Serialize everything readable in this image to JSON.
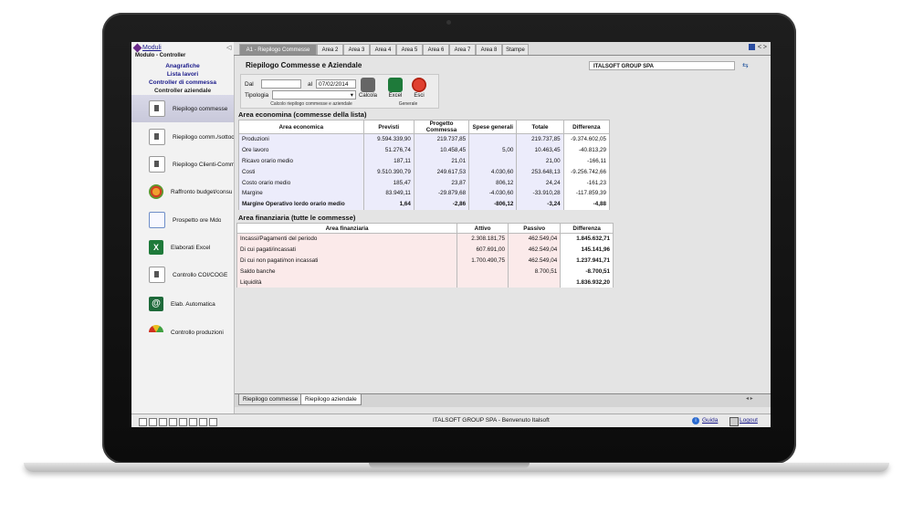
{
  "sidebar": {
    "modules_link": "Moduli",
    "module_name": "Modulo - Controller",
    "links": [
      "Anagrafiche",
      "Lista lavori",
      "Controller di commessa",
      "Controller aziendale"
    ],
    "items": [
      {
        "label": "Riepilogo commesse",
        "icon": "document-icon"
      },
      {
        "label": "Riepilogo comm./sottoc",
        "icon": "document-icon"
      },
      {
        "label": "Riepilogo Clienti-Comm",
        "icon": "document-icon"
      },
      {
        "label": "Raffronto budget/consu",
        "icon": "budget-icon"
      },
      {
        "label": "Prospetto ore Mdo",
        "icon": "calendar-clock-icon"
      },
      {
        "label": "Elaborati Excel",
        "icon": "excel-icon"
      },
      {
        "label": "Controllo COI/COGE",
        "icon": "document-icon"
      },
      {
        "label": "Elab. Automatica",
        "icon": "automation-icon"
      },
      {
        "label": "Controllo produzioni",
        "icon": "gauge-icon"
      }
    ]
  },
  "tabs": [
    "A1 - Riepilogo Commesse",
    "Area 2",
    "Area 3",
    "Area 4",
    "Area 5",
    "Area 6",
    "Area 7",
    "Area 8",
    "Stampe"
  ],
  "top_right": "< >",
  "page_title": "Riepilogo Commesse e Aziendale",
  "company": "ITALSOFT GROUP SPA",
  "filters": {
    "dal_label": "Dal",
    "dal_value": "",
    "al_label": "al",
    "al_value": "07/02/2014",
    "tipologia_label": "Tipologia",
    "tipologia_value": ""
  },
  "toolbar": {
    "calcola": "Calcola",
    "excel": "Excel",
    "esci": "Esci",
    "group1": "Calcolo riepilogo commesse e aziendale",
    "group2": "Generale"
  },
  "economica": {
    "title": "Area economina (commesse della lista)",
    "headers": [
      "Area economica",
      "Previsti",
      "Progetto Commessa",
      "Spese generali",
      "Totale",
      "Differenza"
    ],
    "rows": [
      [
        "Produzioni",
        "9.594.339,90",
        "219.737,85",
        "",
        "219.737,85",
        "-9.374.602,05"
      ],
      [
        "Ore lavoro",
        "51.276,74",
        "10.458,45",
        "5,00",
        "10.463,45",
        "-40.813,29"
      ],
      [
        "Ricavo orario medio",
        "187,11",
        "21,01",
        "",
        "21,00",
        "-166,11"
      ],
      [
        "Costi",
        "9.510.390,79",
        "249.617,53",
        "4.030,60",
        "253.648,13",
        "-9.256.742,66"
      ],
      [
        "Costo orario medio",
        "185,47",
        "23,87",
        "806,12",
        "24,24",
        "-161,23"
      ],
      [
        "Margine",
        "83.949,11",
        "-29.879,68",
        "-4.030,60",
        "-33.910,28",
        "-117.859,39"
      ],
      [
        "Margine Operativo lordo orario medio",
        "1,64",
        "-2,86",
        "-806,12",
        "-3,24",
        "-4,88"
      ]
    ]
  },
  "finanziaria": {
    "title": "Area finanziaria (tutte le commesse)",
    "headers": [
      "Area finanziaria",
      "Attivo",
      "Passivo",
      "Differenza"
    ],
    "rows": [
      [
        "Incassi/Pagamenti del periodo",
        "2.308.181,75",
        "462.549,04",
        "1.845.632,71"
      ],
      [
        "Di cui pagati/incassati",
        "607.691,00",
        "462.549,04",
        "145.141,96"
      ],
      [
        "Di cui non pagati/non incassati",
        "1.700.490,75",
        "462.549,04",
        "1.237.941,71"
      ],
      [
        "Saldo banche",
        "",
        "8.700,51",
        "-8.700,51"
      ],
      [
        "Liquidità",
        "",
        "",
        "1.836.932,20"
      ]
    ]
  },
  "bottom_tabs": [
    "Riepilogo commesse",
    "Riepilogo aziendale"
  ],
  "status": {
    "text": "ITALSOFT GROUP SPA - Benvenuto Italsoft",
    "guide": "Guida",
    "logout": "Logout"
  }
}
